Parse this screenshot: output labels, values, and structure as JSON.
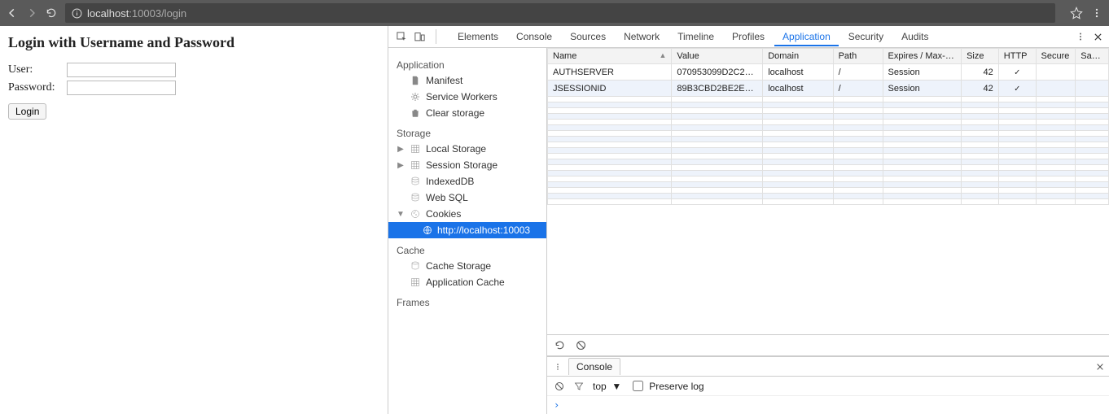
{
  "browser": {
    "url_host": "localhost",
    "url_port_path": ":10003/login"
  },
  "page": {
    "heading": "Login with Username and Password",
    "user_label": "User:",
    "pass_label": "Password:",
    "login_btn": "Login"
  },
  "devtools": {
    "tabs": [
      "Elements",
      "Console",
      "Sources",
      "Network",
      "Timeline",
      "Profiles",
      "Application",
      "Security",
      "Audits"
    ],
    "active_tab": "Application",
    "sidebar": {
      "app_header": "Application",
      "app_items": [
        "Manifest",
        "Service Workers",
        "Clear storage"
      ],
      "storage_header": "Storage",
      "storage_items": [
        "Local Storage",
        "Session Storage",
        "IndexedDB",
        "Web SQL",
        "Cookies"
      ],
      "cookie_origin": "http://localhost:10003",
      "cache_header": "Cache",
      "cache_items": [
        "Cache Storage",
        "Application Cache"
      ],
      "frames_header": "Frames"
    },
    "cookie_cols": [
      "Name",
      "Value",
      "Domain",
      "Path",
      "Expires / Max-Age",
      "Size",
      "HTTP",
      "Secure",
      "SameSite"
    ],
    "cookies": [
      {
        "name": "AUTHSERVER",
        "value": "070953099D2C2…",
        "domain": "localhost",
        "path": "/",
        "expires": "Session",
        "size": "42",
        "http": "✓",
        "secure": "",
        "samesite": ""
      },
      {
        "name": "JSESSIONID",
        "value": "89B3CBD2BE2E…",
        "domain": "localhost",
        "path": "/",
        "expires": "Session",
        "size": "42",
        "http": "✓",
        "secure": "",
        "samesite": ""
      }
    ],
    "console": {
      "tab": "Console",
      "context": "top",
      "preserve_log": "Preserve log",
      "prompt": "›"
    }
  }
}
